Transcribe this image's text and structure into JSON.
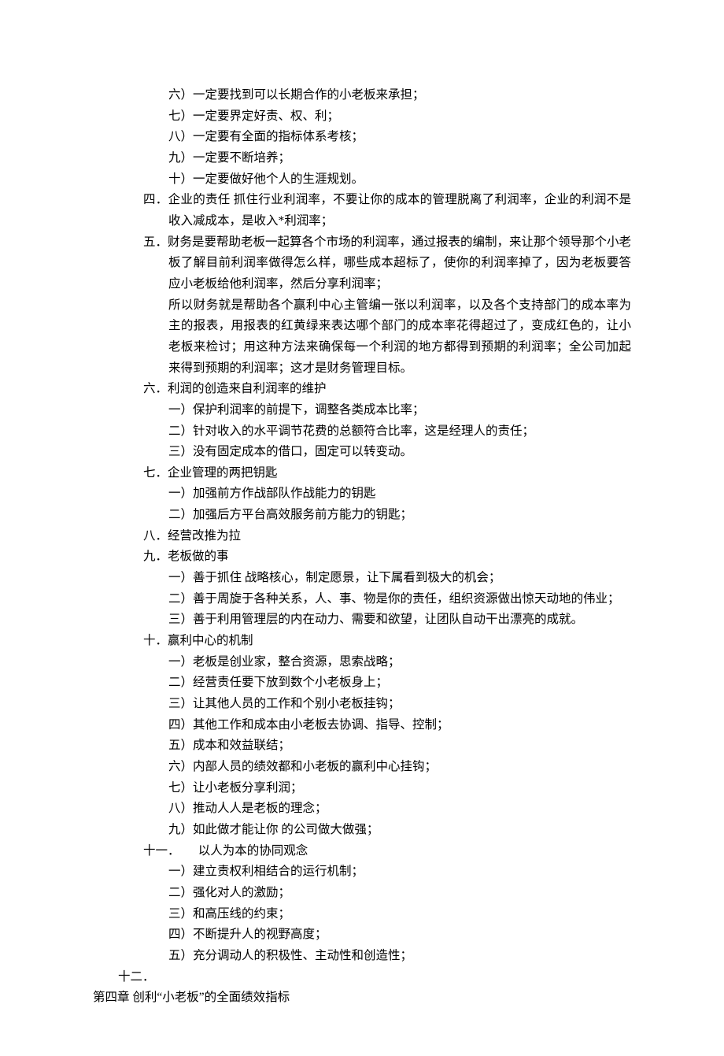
{
  "lines": [
    {
      "indent": 3,
      "text": "六）一定要找到可以长期合作的小老板来承担；"
    },
    {
      "indent": 3,
      "text": "七）一定要界定好责、权、利；"
    },
    {
      "indent": 3,
      "text": "八）一定要有全面的指标体系考核；"
    },
    {
      "indent": 3,
      "text": "九）一定要不断培养；"
    },
    {
      "indent": 3,
      "text": "十）一定要做好他个人的生涯规划。"
    },
    {
      "indent": 2,
      "text": "四．企业的责任 抓住行业利润率，不要让你的成本的管理脱离了利润率，企业的利润不是收入减成本，是收入*利润率；",
      "hanging": true
    },
    {
      "indent": 2,
      "text": "五．财务是要帮助老板一起算各个市场的利润率，通过报表的编制，来让那个领导那个小老板了解目前利润率做得怎么样，哪些成本超标了，使你的利润率掉了，因为老板要答应小老板给他利润率，然后分享利润率；",
      "hanging": true
    },
    {
      "indent": 3,
      "text": "所以财务就是帮助各个赢利中心主管编一张以利润率，以及各个支持部门的成本率为主的报表，用报表的红黄绿来表达哪个部门的成本率花得超过了，变成红色的，让小老板来检讨；用这种方法来确保每一个利润的地方都得到预期的利润率；全公司加起来得到预期的利润率；这才是财务管理目标。"
    },
    {
      "indent": 2,
      "text": "六．利润的创造来自利润率的维护"
    },
    {
      "indent": 3,
      "text": "一）保护利润率的前提下，调整各类成本比率；"
    },
    {
      "indent": 3,
      "text": "二）针对收入的水平调节花费的总额符合比率，这是经理人的责任；"
    },
    {
      "indent": 3,
      "text": "三）没有固定成本的借口，固定可以转变动。"
    },
    {
      "indent": 2,
      "text": "七．企业管理的两把钥匙"
    },
    {
      "indent": 3,
      "text": "一）加强前方作战部队作战能力的钥匙"
    },
    {
      "indent": 3,
      "text": "二）加强后方平台高效服务前方能力的钥匙；"
    },
    {
      "indent": 2,
      "text": "八．经营改推为拉"
    },
    {
      "indent": 2,
      "text": "九．老板做的事"
    },
    {
      "indent": 3,
      "text": "一）善于抓住 战略核心，制定愿景，让下属看到极大的机会；"
    },
    {
      "indent": 3,
      "text": "二）善于周旋于各种关系，人、事、物是你的责任，组织资源做出惊天动地的伟业；"
    },
    {
      "indent": 3,
      "text": "三）善于利用管理层的内在动力、需要和欲望，让团队自动干出漂亮的成就。"
    },
    {
      "indent": 2,
      "text": "十．赢利中心的机制"
    },
    {
      "indent": 3,
      "text": "一）老板是创业家，整合资源，思索战略；"
    },
    {
      "indent": 3,
      "text": "二）经营责任要下放到数个小老板身上；"
    },
    {
      "indent": 3,
      "text": "三）让其他人员的工作和个别小老板挂钩；"
    },
    {
      "indent": 3,
      "text": "四）其他工作和成本由小老板去协调、指导、控制；"
    },
    {
      "indent": 3,
      "text": "五）成本和效益联结；"
    },
    {
      "indent": 3,
      "text": "六）内部人员的绩效都和小老板的赢利中心挂钩；"
    },
    {
      "indent": 3,
      "text": "七）让小老板分享利润；"
    },
    {
      "indent": 3,
      "text": "八）推动人人是老板的理念；"
    },
    {
      "indent": 3,
      "text": "九）如此做才能让你 的公司做大做强；"
    },
    {
      "indent": 2,
      "text": "十一．　　以人为本的协同观念"
    },
    {
      "indent": 3,
      "text": "一）建立责权利相结合的运行机制；"
    },
    {
      "indent": 3,
      "text": "二）强化对人的激励；"
    },
    {
      "indent": 3,
      "text": "三）和高压线的约束；"
    },
    {
      "indent": 3,
      "text": "四）不断提升人的视野高度；"
    },
    {
      "indent": 3,
      "text": "五）充分调动人的积极性、主动性和创造性；"
    },
    {
      "indent": 1,
      "text": "十二．"
    },
    {
      "indent": 0,
      "text": "第四章  创利“小老板”的全面绩效指标"
    }
  ]
}
